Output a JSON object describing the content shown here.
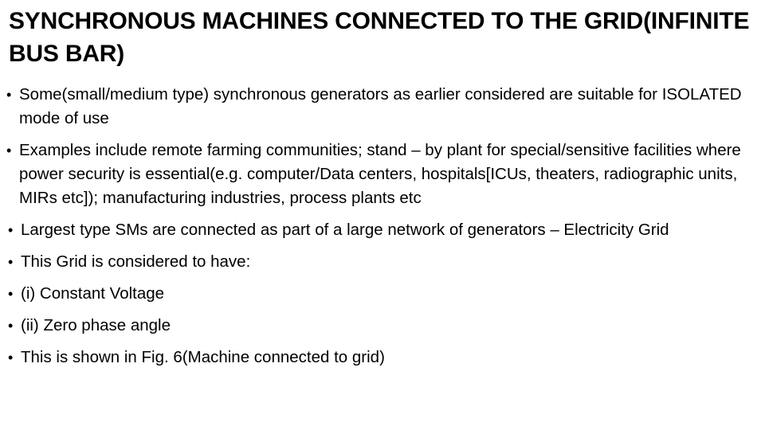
{
  "slide": {
    "title": "SYNCHRONOUS MACHINES CONNECTED TO THE GRID(INFINITE BUS BAR)",
    "bullet_glyph": "•",
    "text_color": "#000000",
    "background_color": "#ffffff",
    "bullets": [
      {
        "id": "bullet-isolated-mode",
        "text": "Some(small/medium type) synchronous generators as earlier considered are suitable for ISOLATED mode of use"
      },
      {
        "id": "bullet-examples",
        "text": "Examples include remote farming communities; stand – by plant for special/sensitive facilities where power security is essential(e.g. computer/Data centers, hospitals[ICUs, theaters, radiographic units, MIRs etc]); manufacturing industries, process plants etc"
      },
      {
        "id": "bullet-largest-sms",
        "text": "Largest type SMs are connected as part of a large network of  generators – Electricity Grid"
      },
      {
        "id": "bullet-grid-considered",
        "text": "This Grid is considered to have:"
      },
      {
        "id": "bullet-constant-voltage",
        "text": "(i) Constant Voltage"
      },
      {
        "id": "bullet-zero-phase-angle",
        "text": "(ii) Zero phase angle"
      },
      {
        "id": "bullet-figure-reference",
        "text": "This is shown in Fig. 6(Machine connected to grid)"
      }
    ]
  }
}
